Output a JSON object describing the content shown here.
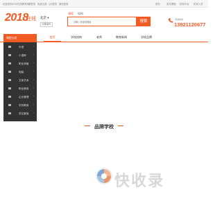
{
  "topbar": {
    "left": [
      "欢迎来到2018在线教育网！",
      "请登录",
      "免费注册",
      "QQ登录",
      "微信登录"
    ],
    "right": [
      "首页",
      "发布课程",
      "机构平台",
      "机构入驻"
    ]
  },
  "header": {
    "logo_number": "2018",
    "logo_cn": "在线",
    "city": "北京",
    "switch_city": "切换城市",
    "search_tabs": [
      "课程",
      "机构"
    ],
    "search_placeholder": "请输入关键词搜索",
    "search_button": "搜索",
    "phone_label": "咨询热线",
    "phone_number": "13921120677"
  },
  "nav": {
    "items": [
      "首页",
      "学校机构",
      "老师",
      "教育新闻",
      "学校品牌"
    ]
  },
  "sidebar": {
    "title": "课程分类",
    "items": [
      "外语",
      "小语种",
      "职业资格",
      "电脑",
      "文体艺术",
      "职业教育",
      "企业管理",
      "学历教育",
      "学生教育"
    ]
  },
  "section": {
    "title": "品牌学校"
  },
  "watermark": {
    "text": "快收录"
  },
  "colors": {
    "accent": "#f15a22",
    "sidebar_bg": "#333333"
  }
}
